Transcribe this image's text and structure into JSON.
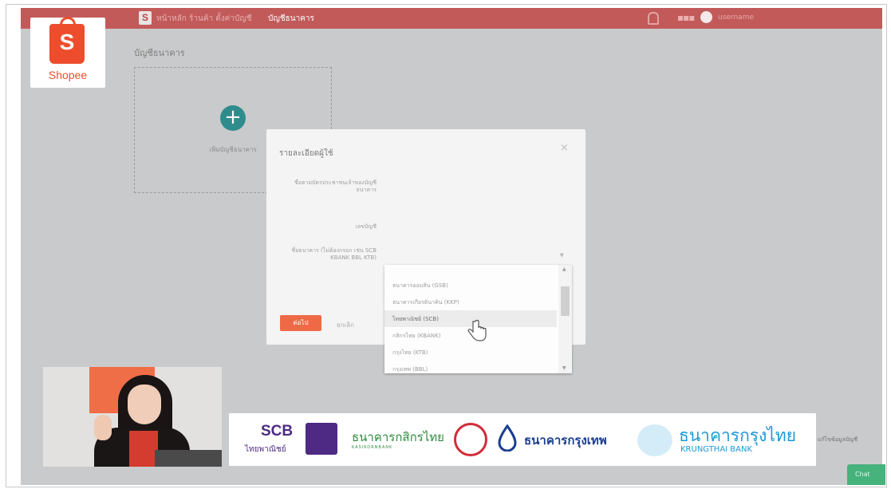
{
  "topbar": {
    "logo_letter": "S",
    "breadcrumb_parent": "หน้าหลัก ร้านค้า ตั้งค่าบัญชี",
    "breadcrumb_current": "บัญชีธนาคาร",
    "username": "username"
  },
  "page": {
    "title": "บัญชีธนาคาร",
    "add_label": "เพิ่มบัญชีธนาคาร",
    "add_symbol": "+"
  },
  "logo": {
    "letter": "S",
    "text": "Shopee",
    "color": "#ee4d2d"
  },
  "modal": {
    "title": "รายละเอียดผู้ใช้",
    "close": "×",
    "labels": {
      "name": "ชื่อตามบัตรประชาชนเจ้าของบัญชีธนาคาร",
      "account_no": "เลขบัญชี",
      "bank": "ชื่อธนาคาร (ไม่ต้องกรอก เช่น SCB KBANK BBL KTB)"
    },
    "confirm": "ต่อไป",
    "cancel": "ยกเลิก"
  },
  "dropdown": {
    "items": [
      {
        "label": "ธนาคารออมสิน (GSB)",
        "active": false
      },
      {
        "label": "ธนาคารเกียรตินาคิน (KKP)",
        "active": false
      },
      {
        "label": "ไทยพาณิชย์ (SCB)",
        "active": true
      },
      {
        "label": "กสิกรไทย (KBANK)",
        "active": false
      },
      {
        "label": "กรุงไทย (KTB)",
        "active": false
      },
      {
        "label": "กรุงเทพ (BBL)",
        "active": false
      }
    ]
  },
  "banks": {
    "scb_name": "SCB",
    "scb_thai": "ไทยพาณิชย์",
    "kasikorn_thai": "ธนาคารกสิกรไทย",
    "kasikorn_en": "KASIKORNBANK",
    "bbl_thai": "ธนาคารกรุงเทพ",
    "ktb_thai": "ธนาคารกรุงไทย",
    "ktb_en": "KRUNGTHAI BANK"
  },
  "side_text": "แก้ไขข้อมูลบัญชี",
  "chat_label": "Chat",
  "colors": {
    "topbar": "#c25a5a",
    "accent": "#ee4d2d",
    "teal": "#2f8c8c",
    "scb": "#4e2a84",
    "kbank": "#2e8b3e",
    "bbl": "#1c3e8f",
    "ktb": "#1a9ad6"
  }
}
